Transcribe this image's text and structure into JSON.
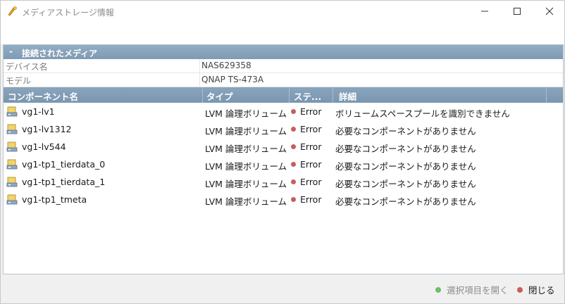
{
  "window": {
    "title": "メディアストレージ情報",
    "icon": "storage-app-icon"
  },
  "section": {
    "toggle": "-",
    "title": "接続されたメディア"
  },
  "properties": [
    {
      "key": "デバイス名",
      "value": "NAS629358"
    },
    {
      "key": "モデル",
      "value": "QNAP TS-473A"
    }
  ],
  "columns": [
    "コンポーネント名",
    "タイプ",
    "ステ...",
    "詳細"
  ],
  "rows": [
    {
      "name": "vg1-lv1",
      "type": "LVM 論理ボリューム",
      "status": "Error",
      "detail": "ボリュームスペースプールを識別できません"
    },
    {
      "name": "vg1-lv1312",
      "type": "LVM 論理ボリューム",
      "status": "Error",
      "detail": "必要なコンポーネントがありません"
    },
    {
      "name": "vg1-lv544",
      "type": "LVM 論理ボリューム",
      "status": "Error",
      "detail": "必要なコンポーネントがありません"
    },
    {
      "name": "vg1-tp1_tierdata_0",
      "type": "LVM 論理ボリューム",
      "status": "Error",
      "detail": "必要なコンポーネントがありません"
    },
    {
      "name": "vg1-tp1_tierdata_1",
      "type": "LVM 論理ボリューム",
      "status": "Error",
      "detail": "必要なコンポーネントがありません"
    },
    {
      "name": "vg1-tp1_tmeta",
      "type": "LVM 論理ボリューム",
      "status": "Error",
      "detail": "必要なコンポーネントがありません"
    }
  ],
  "footer": {
    "open_label": "選択項目を開く",
    "close_label": "閉じる"
  },
  "colors": {
    "header": "#7f9bb4",
    "error": "#c95d5d",
    "open_dot": "#6cbf6c",
    "close_dot": "#c95d5d"
  }
}
